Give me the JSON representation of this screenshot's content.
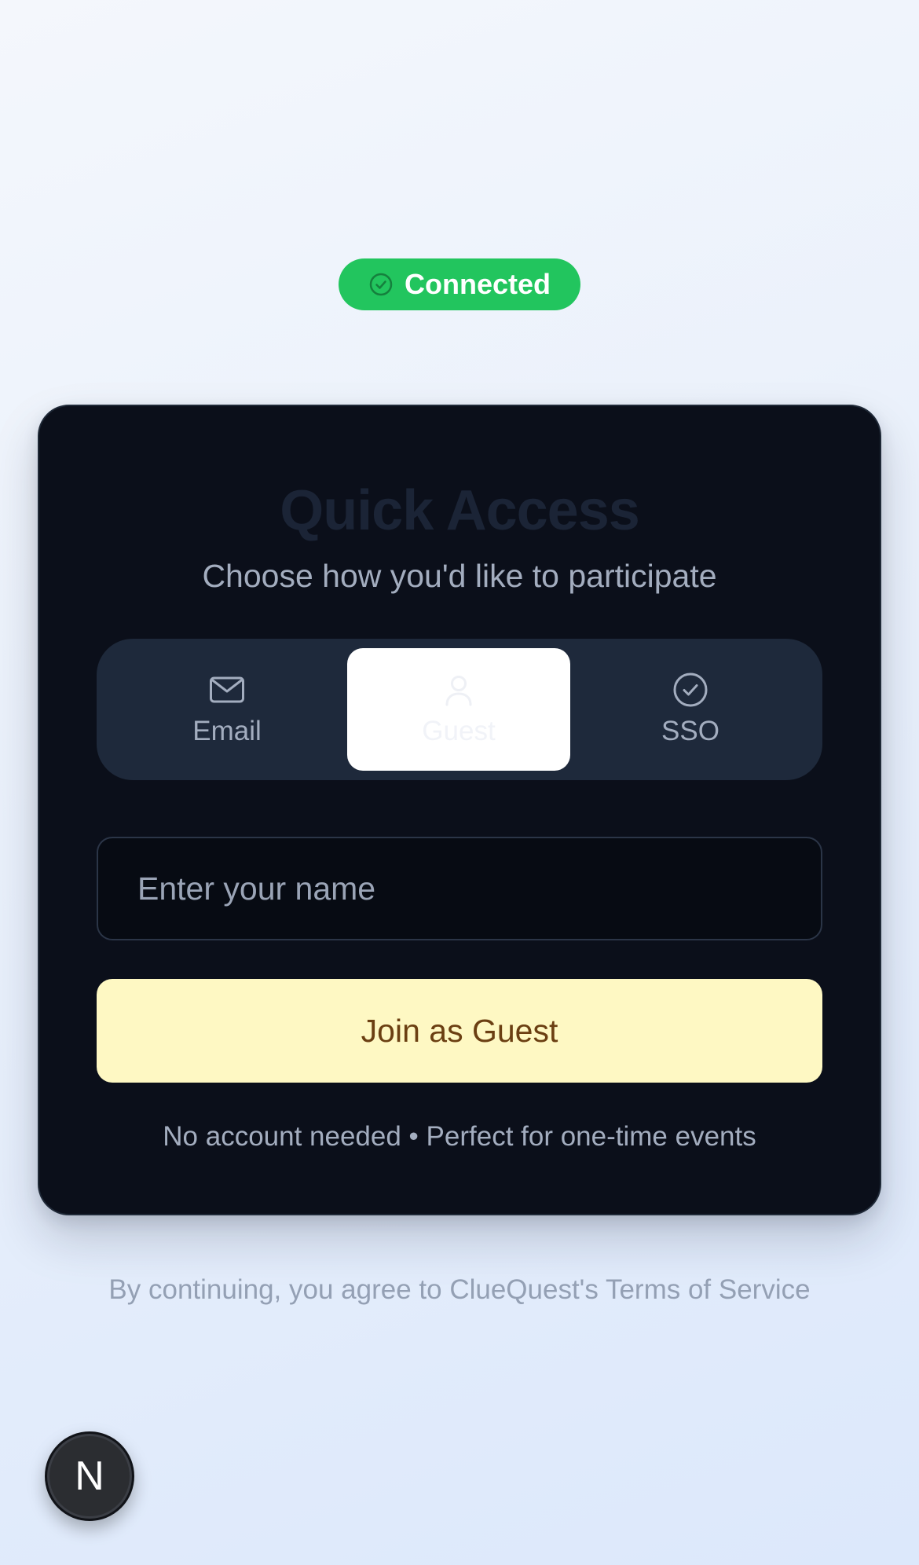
{
  "status": {
    "label": "Connected",
    "icon": "check-circle-icon",
    "color": "#22c55e"
  },
  "card": {
    "title": "Quick Access",
    "subtitle": "Choose how you'd like to participate",
    "tabs": [
      {
        "label": "Email",
        "icon": "mail-icon",
        "selected": false
      },
      {
        "label": "Guest",
        "icon": "user-icon",
        "selected": true
      },
      {
        "label": "SSO",
        "icon": "check-circle-icon",
        "selected": false
      }
    ],
    "name_input": {
      "placeholder": "Enter your name",
      "value": ""
    },
    "join_button": {
      "label": "Join as Guest"
    },
    "note": "No account needed • Perfect for one-time events"
  },
  "footer": {
    "terms": "By continuing, you agree to ClueQuest's Terms of Service"
  },
  "dev_badge": {
    "label": "N"
  },
  "colors": {
    "card_background": "#0b0f1a",
    "tab_bar_background": "#1e293b",
    "join_button_background": "#fef8c3",
    "join_button_text": "#6b3f12"
  }
}
